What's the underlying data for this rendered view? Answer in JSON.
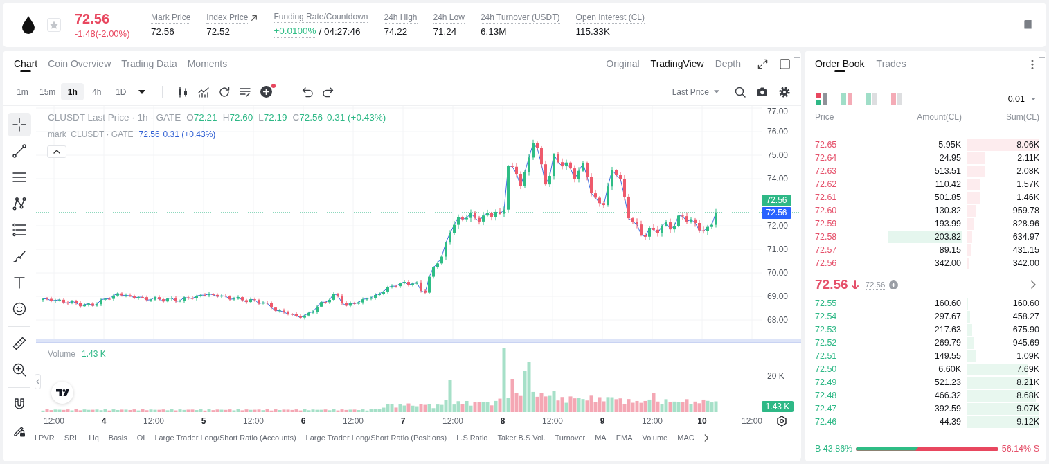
{
  "header": {
    "favorite": false,
    "price": "72.56",
    "change": "-1.48(-2.00%)",
    "stats": [
      {
        "kind": "plain",
        "label": "Mark Price",
        "value": "72.56"
      },
      {
        "kind": "link",
        "label": "Index Price",
        "value": "72.52"
      },
      {
        "kind": "funding",
        "label": "Funding Rate/Countdown",
        "value": "+0.0100%",
        "countdown": "/ 04:27:46"
      },
      {
        "kind": "plain",
        "label": "24h High",
        "value": "74.22"
      },
      {
        "kind": "plain",
        "label": "24h Low",
        "value": "71.24"
      },
      {
        "kind": "plain",
        "label": "24h Turnover (USDT)",
        "value": "6.13M"
      },
      {
        "kind": "plain",
        "label": "Open Interest (CL)",
        "value": "115.33K"
      }
    ]
  },
  "chart_panel": {
    "tabs": [
      {
        "label": "Chart",
        "selected": true
      },
      {
        "label": "Coin Overview",
        "selected": false
      },
      {
        "label": "Trading Data",
        "selected": false
      },
      {
        "label": "Moments",
        "selected": false
      }
    ],
    "view_modes": [
      {
        "label": "Original",
        "selected": false
      },
      {
        "label": "TradingView",
        "selected": true
      },
      {
        "label": "Depth",
        "selected": false
      }
    ],
    "intervals": [
      {
        "label": "1m",
        "selected": false
      },
      {
        "label": "15m",
        "selected": false
      },
      {
        "label": "1h",
        "selected": true
      },
      {
        "label": "4h",
        "selected": false
      },
      {
        "label": "1D",
        "selected": false
      }
    ],
    "price_source": "Last Price",
    "drawing_tools": [
      {
        "selected": true
      },
      {
        "selected": false
      },
      {
        "selected": false
      },
      {
        "selected": false
      },
      {
        "selected": false
      },
      {
        "selected": false
      },
      {
        "selected": false
      },
      {
        "selected": false
      },
      {
        "selected": false
      },
      {
        "selected": false
      },
      {
        "selected": false
      },
      {
        "selected": false
      }
    ],
    "legend": {
      "title": "CLUSDT Last Price · 1h · GATE",
      "ohlc": [
        {
          "key": "O",
          "value": "72.21"
        },
        {
          "key": "H",
          "value": "72.60"
        },
        {
          "key": "L",
          "value": "72.19"
        },
        {
          "key": "C",
          "value": "72.56"
        }
      ],
      "change": "0.31 (+0.43%)"
    },
    "mark_legend": {
      "title": "mark_CLUSDT · GATE",
      "value": "72.56",
      "change": "0.31 (+0.43%)"
    },
    "price_axis": [
      "77.00",
      "76.00",
      "75.00",
      "74.00",
      "72.00",
      "71.00",
      "70.00",
      "69.00",
      "68.00"
    ],
    "price_tags": [
      {
        "kind": "last",
        "value": "72.56"
      },
      {
        "kind": "mark",
        "value": "72.56"
      }
    ],
    "volume": {
      "label": "Volume",
      "value": "1.43 K",
      "axis": [
        "20 K"
      ],
      "tag": "1.43 K"
    },
    "time_axis": [
      {
        "kind": "time",
        "label": "12:00"
      },
      {
        "kind": "day",
        "label": "4"
      },
      {
        "kind": "time",
        "label": "12:00"
      },
      {
        "kind": "day",
        "label": "5"
      },
      {
        "kind": "time",
        "label": "12:00"
      },
      {
        "kind": "day",
        "label": "6"
      },
      {
        "kind": "time",
        "label": "12:00"
      },
      {
        "kind": "day",
        "label": "7"
      },
      {
        "kind": "time",
        "label": "12:00"
      },
      {
        "kind": "day",
        "label": "8"
      },
      {
        "kind": "time",
        "label": "12:00"
      },
      {
        "kind": "day",
        "label": "9"
      },
      {
        "kind": "time",
        "label": "12:00"
      },
      {
        "kind": "day",
        "label": "10"
      },
      {
        "kind": "time",
        "label": "12:00"
      }
    ],
    "indicators": [
      "LPVR",
      "SRL",
      "Liq",
      "Basis",
      "OI",
      "Large Trader Long/Short Ratio (Accounts)",
      "Large Trader Long/Short Ratio (Positions)",
      "L.S Ratio",
      "Taker B.S Vol.",
      "Turnover",
      "MA",
      "EMA",
      "Volume",
      "MAC"
    ]
  },
  "order_book": {
    "tabs": [
      {
        "label": "Order Book",
        "selected": true
      },
      {
        "label": "Trades",
        "selected": false
      }
    ],
    "layouts": [
      {
        "selected": true
      },
      {
        "selected": false
      },
      {
        "selected": false
      },
      {
        "selected": false
      }
    ],
    "precision": "0.01",
    "columns": [
      "Price",
      "Amount(CL)",
      "Sum(CL)"
    ],
    "asks": [
      {
        "price": "72.65",
        "amount": "5.95K",
        "sum": "8.06K",
        "highlighted": false
      },
      {
        "price": "72.64",
        "amount": "24.95",
        "sum": "2.11K",
        "highlighted": false
      },
      {
        "price": "72.63",
        "amount": "513.51",
        "sum": "2.08K",
        "highlighted": false
      },
      {
        "price": "72.62",
        "amount": "110.42",
        "sum": "1.57K",
        "highlighted": false
      },
      {
        "price": "72.61",
        "amount": "501.85",
        "sum": "1.46K",
        "highlighted": false
      },
      {
        "price": "72.60",
        "amount": "130.82",
        "sum": "959.78",
        "highlighted": false
      },
      {
        "price": "72.59",
        "amount": "193.99",
        "sum": "828.96",
        "highlighted": false
      },
      {
        "price": "72.58",
        "amount": "203.82",
        "sum": "634.97",
        "highlighted": true
      },
      {
        "price": "72.57",
        "amount": "89.15",
        "sum": "431.15",
        "highlighted": false
      },
      {
        "price": "72.56",
        "amount": "342.00",
        "sum": "342.00",
        "highlighted": false
      }
    ],
    "last_price": {
      "value": "72.56",
      "falling": true,
      "mark": "72.56"
    },
    "bids": [
      {
        "price": "72.55",
        "amount": "160.60",
        "sum": "160.60",
        "highlighted": false
      },
      {
        "price": "72.54",
        "amount": "297.67",
        "sum": "458.27",
        "highlighted": false
      },
      {
        "price": "72.53",
        "amount": "217.63",
        "sum": "675.90",
        "highlighted": false
      },
      {
        "price": "72.52",
        "amount": "269.79",
        "sum": "945.69",
        "highlighted": false
      },
      {
        "price": "72.51",
        "amount": "149.55",
        "sum": "1.09K",
        "highlighted": false
      },
      {
        "price": "72.50",
        "amount": "6.60K",
        "sum": "7.69K",
        "highlighted": false
      },
      {
        "price": "72.49",
        "amount": "521.23",
        "sum": "8.21K",
        "highlighted": false
      },
      {
        "price": "72.48",
        "amount": "466.32",
        "sum": "8.68K",
        "highlighted": false
      },
      {
        "price": "72.47",
        "amount": "392.59",
        "sum": "9.07K",
        "highlighted": false
      },
      {
        "price": "72.46",
        "amount": "44.39",
        "sum": "9.12K",
        "highlighted": false
      }
    ],
    "ratio": {
      "buy": "B 43.86%",
      "sell": "56.14% S",
      "level": 0.4386
    }
  }
}
